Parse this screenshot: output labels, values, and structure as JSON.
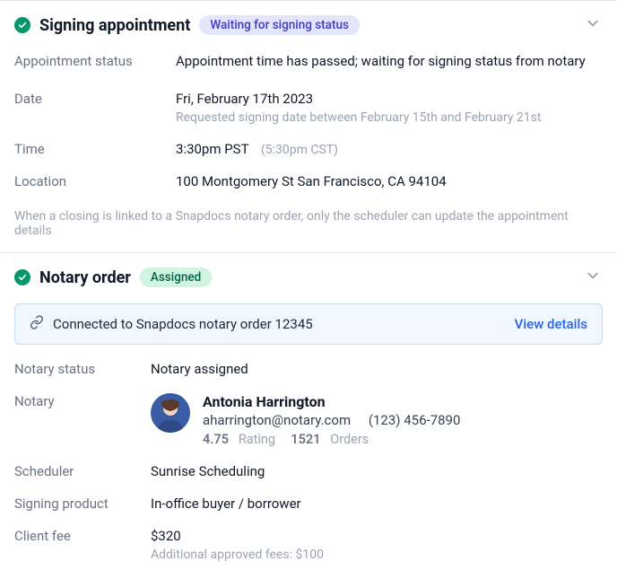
{
  "signing": {
    "title": "Signing appointment",
    "badge": "Waiting for signing status",
    "status_label": "Appointment status",
    "status_value": "Appointment time has passed; waiting for signing status from notary",
    "date_label": "Date",
    "date_value": "Fri, February 17th 2023",
    "date_note": "Requested signing date between February 15th and February 21st",
    "time_label": "Time",
    "time_value": "3:30pm PST",
    "time_alt": "(5:30pm CST)",
    "location_label": "Location",
    "location_value": "100 Montgomery St San Francisco, CA 94104",
    "footer_note": "When a closing is linked to a Snapdocs notary order, only the scheduler can update the appointment details"
  },
  "notary_order": {
    "title": "Notary order",
    "badge": "Assigned",
    "connected_text": "Connected to Snapdocs notary order 12345",
    "view_details": "View details",
    "status_label": "Notary status",
    "status_value": "Notary assigned",
    "notary_label": "Notary",
    "notary_name": "Antonia Harrington",
    "notary_email": "aharrington@notary.com",
    "notary_phone": "(123) 456-7890",
    "rating_value": "4.75",
    "rating_label": "Rating",
    "orders_value": "1521",
    "orders_label": "Orders",
    "scheduler_label": "Scheduler",
    "scheduler_value": "Sunrise Scheduling",
    "product_label": "Signing product",
    "product_value": "In-office buyer / borrower",
    "fee_label": "Client fee",
    "fee_value": "$320",
    "fee_note": "Additional approved fees: $100"
  }
}
